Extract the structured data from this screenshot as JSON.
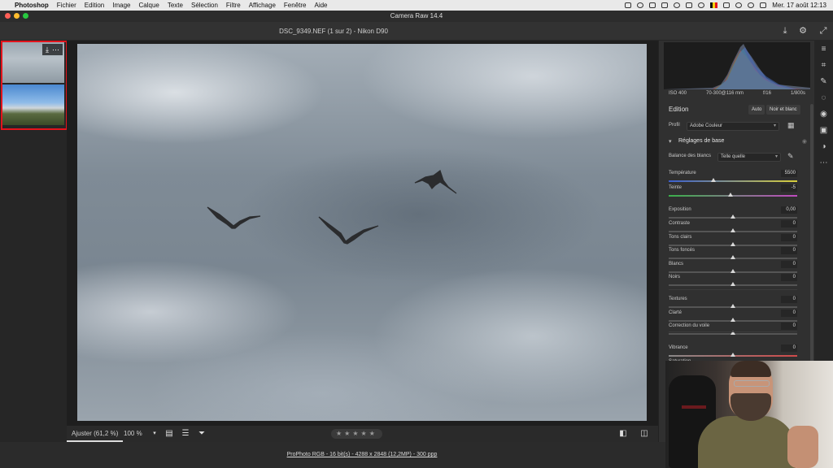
{
  "menubar": {
    "apple_icon": "apple-logo-icon",
    "items": [
      "Photoshop",
      "Fichier",
      "Edition",
      "Image",
      "Calque",
      "Texte",
      "Sélection",
      "Filtre",
      "Affichage",
      "Fenêtre",
      "Aide"
    ],
    "clock": "Mer. 17 août  12:13"
  },
  "window": {
    "title": "Camera Raw 14.4"
  },
  "header": {
    "file_info": "DSC_9349.NEF (1 sur 2)  -  Nikon D90"
  },
  "filmstrip": {
    "selected_index": 0,
    "thumbnail_count": 2
  },
  "histogram_info": {
    "iso": "ISO 400",
    "lens": "70-300@116 mm",
    "aperture": "f/16",
    "shutter": "1/800s"
  },
  "edit_panel": {
    "title": "Edition",
    "auto_label": "Auto",
    "bw_label": "Noir et blanc",
    "profile_label": "Profil",
    "profile_value": "Adobe Couleur",
    "section_title": "Réglages de base",
    "wb_label": "Balance des blancs",
    "wb_value": "Telle quelle",
    "sliders": [
      {
        "label": "Température",
        "value": "5500",
        "position": 0.35
      },
      {
        "label": "Teinte",
        "value": "-5",
        "position": 0.48
      },
      {
        "label": "Exposition",
        "value": "0,00",
        "position": 0.5
      },
      {
        "label": "Contraste",
        "value": "0",
        "position": 0.5
      },
      {
        "label": "Tons clairs",
        "value": "0",
        "position": 0.5
      },
      {
        "label": "Tons foncés",
        "value": "0",
        "position": 0.5
      },
      {
        "label": "Blancs",
        "value": "0",
        "position": 0.5
      },
      {
        "label": "Noirs",
        "value": "0",
        "position": 0.5
      },
      {
        "label": "Textures",
        "value": "0",
        "position": 0.5
      },
      {
        "label": "Clarté",
        "value": "0",
        "position": 0.5
      },
      {
        "label": "Correction du voile",
        "value": "0",
        "position": 0.5
      },
      {
        "label": "Vibrance",
        "value": "0",
        "position": 0.5
      },
      {
        "label": "Saturation",
        "value": "",
        "position": 0.5
      }
    ]
  },
  "bottombar": {
    "fit_label": "Ajuster (61,2 %)",
    "zoom_label": "100 %",
    "rating_stars": "★★★★★"
  },
  "statusbar": {
    "meta": "ProPhoto RGB - 16 bit(s) - 4288 x 2848 (12,2MP) - 300 ppp"
  },
  "colors": {
    "selection_red": "#e3141c",
    "panel_bg": "#303030",
    "canvas_bg": "#1e1e1e"
  }
}
